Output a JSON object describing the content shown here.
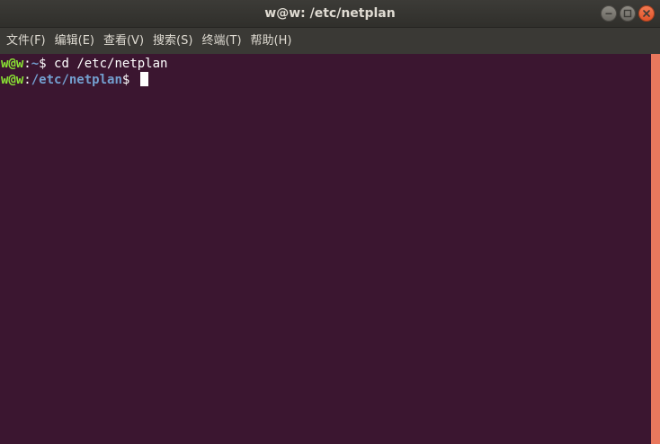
{
  "window": {
    "title": "w@w: /etc/netplan",
    "controls": {
      "minimize_icon": "minimize-icon",
      "maximize_icon": "maximize-icon",
      "close_icon": "close-icon"
    }
  },
  "menu": [
    {
      "label": "文件(F)"
    },
    {
      "label": "编辑(E)"
    },
    {
      "label": "查看(V)"
    },
    {
      "label": "搜索(S)"
    },
    {
      "label": "终端(T)"
    },
    {
      "label": "帮助(H)"
    }
  ],
  "terminal": {
    "lines": [
      {
        "user": "w@w",
        "sep": ":",
        "path": "~",
        "prompt": "$ ",
        "command": "cd /etc/netplan"
      },
      {
        "user": "w@w",
        "sep": ":",
        "path": "/etc/netplan",
        "prompt": "$ ",
        "command": ""
      }
    ]
  },
  "colors": {
    "terminal_bg": "#3b1630",
    "user": "#8ae234",
    "path": "#739fcf",
    "scrollbar": "#e9785d",
    "close_button": "#e95420"
  }
}
